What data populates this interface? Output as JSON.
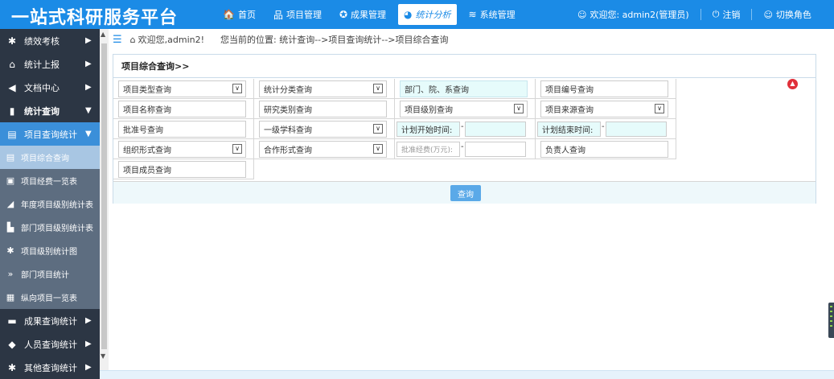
{
  "app": {
    "title": "一站式科研服务平台"
  },
  "nav": [
    {
      "label": "首页",
      "icon": "home-icon",
      "glyph": "🏠",
      "active": false
    },
    {
      "label": "项目管理",
      "icon": "org-icon",
      "glyph": "品",
      "active": false
    },
    {
      "label": "成果管理",
      "icon": "award-icon",
      "glyph": "✪",
      "active": false
    },
    {
      "label": "统计分析",
      "icon": "pie-chart-icon",
      "glyph": "◕",
      "active": true
    },
    {
      "label": "系统管理",
      "icon": "database-icon",
      "glyph": "≋",
      "active": false
    }
  ],
  "user": {
    "welcome": "欢迎您:  admin2(管理员)",
    "logout": "注销",
    "switch_role": "切换角色"
  },
  "sidebar": {
    "items": [
      {
        "label": "绩效考核",
        "icon": "cog-icon",
        "glyph": "✱"
      },
      {
        "label": "统计上报",
        "icon": "home-icon",
        "glyph": "⌂"
      },
      {
        "label": "文档中心",
        "icon": "megaphone-icon",
        "glyph": "◀"
      },
      {
        "label": "统计查询",
        "icon": "bar-chart-icon",
        "glyph": "▮"
      },
      {
        "label": "项目查询统计",
        "icon": "document-icon",
        "glyph": "▤"
      }
    ],
    "subitems": [
      {
        "label": "项目综合查询",
        "icon": "document-icon",
        "glyph": "▤"
      },
      {
        "label": "项目经费一览表",
        "icon": "table-icon",
        "glyph": "▣"
      },
      {
        "label": "年度项目级别统计表",
        "icon": "signal-icon",
        "glyph": "◢"
      },
      {
        "label": "部门项目级别统计表",
        "icon": "file-icon",
        "glyph": "▙"
      },
      {
        "label": "项目级别统计图",
        "icon": "cog-icon",
        "glyph": "✱"
      },
      {
        "label": "部门项目统计",
        "icon": "double-chevron-icon",
        "glyph": "»"
      },
      {
        "label": "纵向项目一览表",
        "icon": "id-card-icon",
        "glyph": "▦"
      }
    ],
    "more": [
      {
        "label": "成果查询统计",
        "icon": "chat-icon",
        "glyph": "▬"
      },
      {
        "label": "人员查询统计",
        "icon": "shield-icon",
        "glyph": "◆"
      },
      {
        "label": "其他查询统计",
        "icon": "cog-icon",
        "glyph": "✱"
      }
    ]
  },
  "breadcrumb": {
    "welcome": "欢迎您,admin2!",
    "position": "您当前的位置:  统计查询-->项目查询统计-->项目综合查询"
  },
  "panel": {
    "title": "项目综合查询>>"
  },
  "fields": {
    "project_type": "项目类型查询",
    "stat_category": "统计分类查询",
    "department": "部门、院、系查询",
    "project_number": "项目编号查询",
    "project_name": "项目名称查询",
    "research_category": "研究类别查询",
    "project_level": "项目级别查询",
    "project_source": "项目来源查询",
    "approval_number": "批准号查询",
    "first_discipline": "一级学科查询",
    "plan_start": "计划开始时间:",
    "plan_end": "计划结束时间:",
    "org_form": "组织形式查询",
    "coop_form": "合作形式查询",
    "approved_funds": "批准经费(万元):",
    "leader": "负责人查询",
    "members": "项目成员查询"
  },
  "actions": {
    "query": "查询"
  },
  "colors": {
    "topbar": "#1b8be6",
    "sidebar": "#2c3644",
    "highlight": "#3b8fd9"
  }
}
